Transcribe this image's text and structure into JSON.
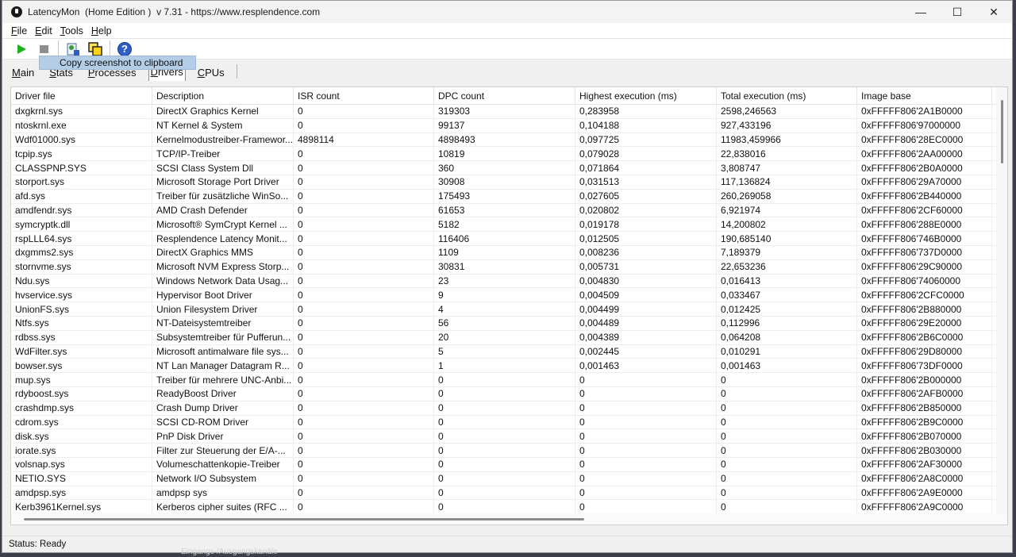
{
  "window": {
    "title": "LatencyMon  (Home Edition )  v 7.31 - https://www.resplendence.com",
    "controls": {
      "minimize": "—",
      "maximize": "☐",
      "close": "✕"
    }
  },
  "menu": [
    {
      "ul": "F",
      "rest": "ile"
    },
    {
      "ul": "E",
      "rest": "dit"
    },
    {
      "ul": "T",
      "rest": "ools"
    },
    {
      "ul": "H",
      "rest": "elp"
    }
  ],
  "toolbar": {
    "help_glyph": "?",
    "tooltip": "Copy screenshot to clipboard"
  },
  "tabs": [
    {
      "ul": "M",
      "rest": "ain"
    },
    {
      "ul": "S",
      "rest": "tats"
    },
    {
      "ul": "P",
      "rest": "rocesses"
    },
    {
      "ul": "D",
      "rest": "rivers"
    },
    {
      "ul": "C",
      "rest": "PUs"
    }
  ],
  "table": {
    "columns": [
      "Driver file",
      "Description",
      "ISR count",
      "DPC count",
      "Highest execution (ms)",
      "Total execution (ms)",
      "Image base"
    ],
    "rows": [
      [
        "dxgkrnl.sys",
        "DirectX Graphics Kernel",
        "0",
        "319303",
        "0,283958",
        "2598,246563",
        "0xFFFFF806'2A1B0000"
      ],
      [
        "ntoskrnl.exe",
        "NT Kernel & System",
        "0",
        "99137",
        "0,104188",
        "927,433196",
        "0xFFFFF806'97000000"
      ],
      [
        "Wdf01000.sys",
        "Kernelmodustreiber-Framewor...",
        "4898114",
        "4898493",
        "0,097725",
        "11983,459966",
        "0xFFFFF806'28EC0000"
      ],
      [
        "tcpip.sys",
        "TCP/IP-Treiber",
        "0",
        "10819",
        "0,079028",
        "22,838016",
        "0xFFFFF806'2AA00000"
      ],
      [
        "CLASSPNP.SYS",
        "SCSI Class System Dll",
        "0",
        "360",
        "0,071864",
        "3,808747",
        "0xFFFFF806'2B0A0000"
      ],
      [
        "storport.sys",
        "Microsoft Storage Port Driver",
        "0",
        "30908",
        "0,031513",
        "117,136824",
        "0xFFFFF806'29A70000"
      ],
      [
        "afd.sys",
        "Treiber für zusätzliche WinSo...",
        "0",
        "175493",
        "0,027605",
        "260,269058",
        "0xFFFFF806'2B440000"
      ],
      [
        "amdfendr.sys",
        "AMD Crash Defender",
        "0",
        "61653",
        "0,020802",
        "6,921974",
        "0xFFFFF806'2CF60000"
      ],
      [
        "symcryptk.dll",
        "Microsoft® SymCrypt Kernel ...",
        "0",
        "5182",
        "0,019178",
        "14,200802",
        "0xFFFFF806'288E0000"
      ],
      [
        "rspLLL64.sys",
        "Resplendence Latency Monit...",
        "0",
        "116406",
        "0,012505",
        "190,685140",
        "0xFFFFF806'746B0000"
      ],
      [
        "dxgmms2.sys",
        "DirectX Graphics MMS",
        "0",
        "1109",
        "0,008236",
        "7,189379",
        "0xFFFFF806'737D0000"
      ],
      [
        "stornvme.sys",
        "Microsoft NVM Express Storp...",
        "0",
        "30831",
        "0,005731",
        "22,653236",
        "0xFFFFF806'29C90000"
      ],
      [
        "Ndu.sys",
        "Windows Network Data Usag...",
        "0",
        "23",
        "0,004830",
        "0,016413",
        "0xFFFFF806'74060000"
      ],
      [
        "hvservice.sys",
        "Hypervisor Boot Driver",
        "0",
        "9",
        "0,004509",
        "0,033467",
        "0xFFFFF806'2CFC0000"
      ],
      [
        "UnionFS.sys",
        "Union Filesystem Driver",
        "0",
        "4",
        "0,004499",
        "0,012425",
        "0xFFFFF806'2B880000"
      ],
      [
        "Ntfs.sys",
        "NT-Dateisystemtreiber",
        "0",
        "56",
        "0,004489",
        "0,112996",
        "0xFFFFF806'29E20000"
      ],
      [
        "rdbss.sys",
        "Subsystemtreiber für Pufferun...",
        "0",
        "20",
        "0,004389",
        "0,064208",
        "0xFFFFF806'2B6C0000"
      ],
      [
        "WdFilter.sys",
        "Microsoft antimalware file sys...",
        "0",
        "5",
        "0,002445",
        "0,010291",
        "0xFFFFF806'29D80000"
      ],
      [
        "bowser.sys",
        "NT Lan Manager Datagram R...",
        "0",
        "1",
        "0,001463",
        "0,001463",
        "0xFFFFF806'73DF0000"
      ],
      [
        "mup.sys",
        "Treiber für mehrere UNC-Anbi...",
        "0",
        "0",
        "0",
        "0",
        "0xFFFFF806'2B000000"
      ],
      [
        "rdyboost.sys",
        "ReadyBoost Driver",
        "0",
        "0",
        "0",
        "0",
        "0xFFFFF806'2AFB0000"
      ],
      [
        "crashdmp.sys",
        "Crash Dump Driver",
        "0",
        "0",
        "0",
        "0",
        "0xFFFFF806'2B850000"
      ],
      [
        "cdrom.sys",
        "SCSI CD-ROM Driver",
        "0",
        "0",
        "0",
        "0",
        "0xFFFFF806'2B9C0000"
      ],
      [
        "disk.sys",
        "PnP Disk Driver",
        "0",
        "0",
        "0",
        "0",
        "0xFFFFF806'2B070000"
      ],
      [
        "iorate.sys",
        "Filter zur Steuerung der E/A-...",
        "0",
        "0",
        "0",
        "0",
        "0xFFFFF806'2B030000"
      ],
      [
        "volsnap.sys",
        "Volumeschattenkopie-Treiber",
        "0",
        "0",
        "0",
        "0",
        "0xFFFFF806'2AF30000"
      ],
      [
        "NETIO.SYS",
        "Network I/O Subsystem",
        "0",
        "0",
        "0",
        "0",
        "0xFFFFF806'2A8C0000"
      ],
      [
        "amdpsp.sys",
        "amdpsp sys",
        "0",
        "0",
        "0",
        "0",
        "0xFFFFF806'2A9E0000"
      ],
      [
        "Kerb3961Kernel.sys",
        "Kerberos cipher suites (RFC ...",
        "0",
        "0",
        "0",
        "0",
        "0xFFFFF806'2A9C0000"
      ]
    ]
  },
  "status": "Status: Ready",
  "taskbar_text": "Eingangs-/Ausgangskanäle"
}
